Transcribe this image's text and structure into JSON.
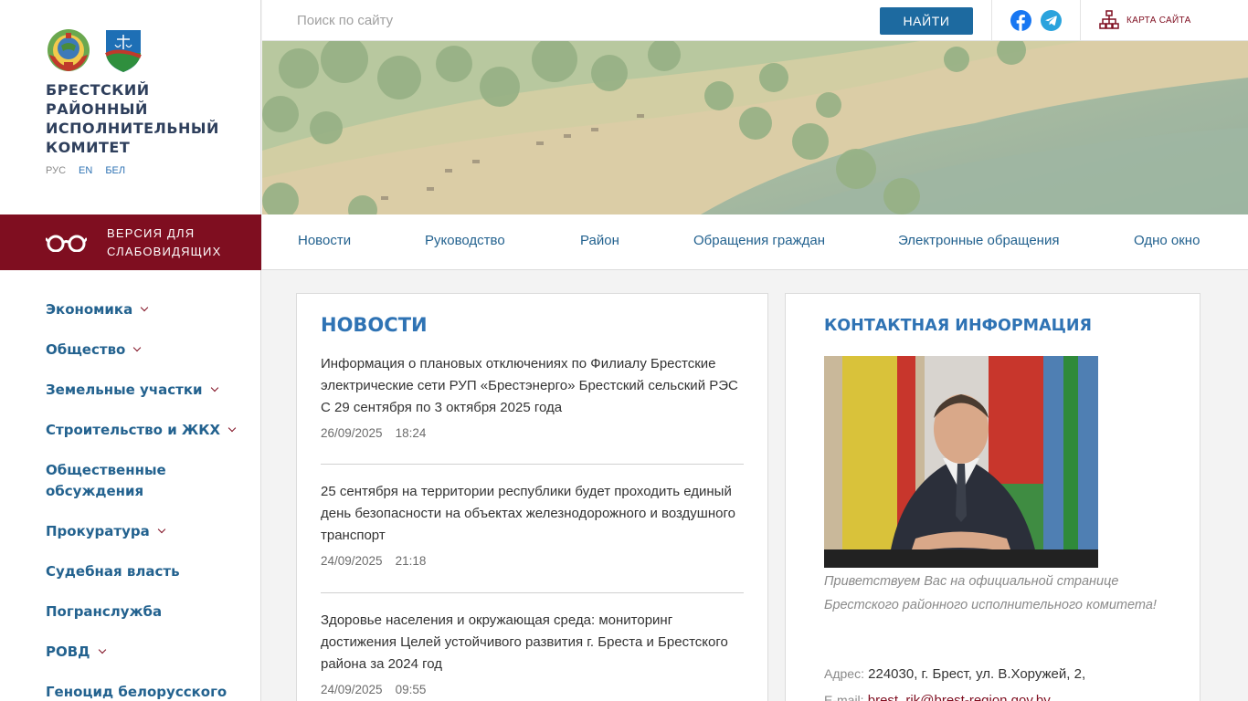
{
  "site": {
    "org_name": "БРЕСТСКИЙ РАЙОННЫЙ ИСПОЛНИТЕЛЬНЫЙ КОМИТЕТ",
    "languages": [
      "РУС",
      "EN",
      "БЕЛ"
    ],
    "low_vision_label": "ВЕРСИЯ ДЛЯ СЛАБОВИДЯЩИХ"
  },
  "topbar": {
    "search_placeholder": "Поиск по сайту",
    "search_button": "НАЙТИ",
    "social": [
      "facebook-icon",
      "telegram-icon"
    ],
    "sitemap_label": "КАРТА САЙТА"
  },
  "main_nav": [
    "Новости",
    "Руководство",
    "Район",
    "Обращения граждан",
    "Электронные обращения",
    "Одно окно"
  ],
  "sidebar_menu": [
    {
      "label": "Экономика",
      "has_submenu": true
    },
    {
      "label": "Общество",
      "has_submenu": true
    },
    {
      "label": "Земельные участки",
      "has_submenu": true
    },
    {
      "label": "Строительство и ЖКХ",
      "has_submenu": true
    },
    {
      "label": "Общественные обсуждения",
      "has_submenu": false
    },
    {
      "label": "Прокуратура",
      "has_submenu": true
    },
    {
      "label": "Судебная власть",
      "has_submenu": false
    },
    {
      "label": "Погранслужба",
      "has_submenu": false
    },
    {
      "label": "РОВД",
      "has_submenu": true
    },
    {
      "label": "Геноцид белорусского",
      "has_submenu": false
    }
  ],
  "news": {
    "title": "НОВОСТИ",
    "items": [
      {
        "text": "Информация о плановых отключениях по Филиалу Брестские электрические сети РУП «Брестэнерго» Брестский сельский РЭС С 29 сентября по 3 октября 2025 года",
        "date": "26/09/2025",
        "time": "18:24"
      },
      {
        "text": "25 сентября на территории республики будет проходить единый день безопасности на объектах железнодорожного и воздушного транспорт",
        "date": "24/09/2025",
        "time": "21:18"
      },
      {
        "text": "Здоровье населения и окружающая среда: мониторинг достижения Целей устойчивого развития г. Бреста и Брестского района за 2024 год",
        "date": "24/09/2025",
        "time": "09:55"
      }
    ]
  },
  "contact": {
    "title": "КОНТАКТНАЯ ИНФОРМАЦИЯ",
    "greeting": "Приветствуем Вас на официальной странице Брестского районного исполнительного комитета!",
    "address_label": "Адрес:",
    "address": "224030, г. Брест, ул. В.Хоружей, 2,",
    "email_label": "E-mail:",
    "email": "brest_rik@brest-region.gov.by"
  },
  "colors": {
    "primary_blue": "#2f73b4",
    "nav_blue": "#23628f",
    "accent_maroon": "#7f0e20",
    "button_blue": "#1d6aa0"
  }
}
